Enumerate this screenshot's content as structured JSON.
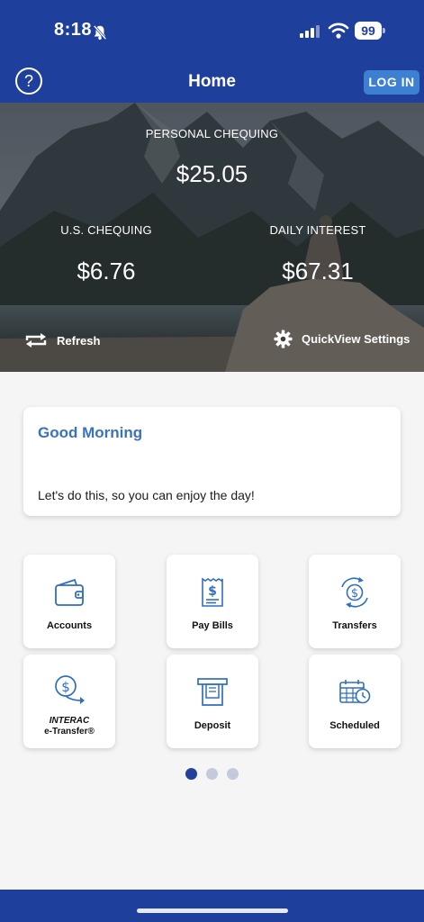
{
  "status": {
    "time": "8:18",
    "battery": "99"
  },
  "header": {
    "help_symbol": "?",
    "title": "Home",
    "login_label": "LOG IN"
  },
  "hero": {
    "primary": {
      "label": "PERSONAL CHEQUING",
      "amount": "$25.05"
    },
    "secondary": [
      {
        "label": "U.S. CHEQUING",
        "amount": "$6.76"
      },
      {
        "label": "DAILY INTEREST",
        "amount": "$67.31"
      }
    ],
    "refresh_label": "Refresh",
    "settings_label": "QuickView Settings"
  },
  "greeting": {
    "title": "Good Morning",
    "message": "Let's do this, so you can enjoy the day!"
  },
  "tiles": [
    {
      "label": "Accounts",
      "icon": "wallet-icon"
    },
    {
      "label": "Pay Bills",
      "icon": "bill-icon"
    },
    {
      "label": "Transfers",
      "icon": "transfer-icon"
    },
    {
      "label_top": "INTERAC",
      "label": "e-Transfer®",
      "icon": "etransfer-icon"
    },
    {
      "label": "Deposit",
      "icon": "atm-deposit-icon"
    },
    {
      "label": "Scheduled",
      "icon": "calendar-clock-icon"
    }
  ],
  "pager": {
    "pages": 3,
    "active": 0
  },
  "colors": {
    "brand": "#1f3f9c",
    "accent": "#3a72bd",
    "login": "#3d7fd0"
  }
}
